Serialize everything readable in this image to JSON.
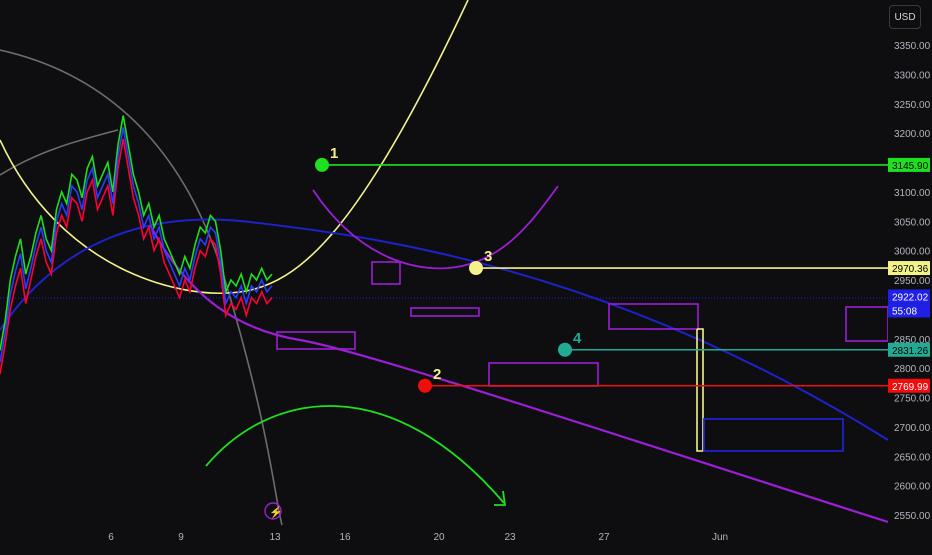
{
  "toolbar": {
    "currency_label": "USD"
  },
  "colors": {
    "background": "#0e0e10",
    "axis_text": "#b2b5be",
    "green_level": "#1ee01e",
    "yellow_level": "#f3f38a",
    "teal_level": "#22ab94",
    "red_level": "#f20d0d",
    "blue_curve": "#1e22cc",
    "purple_curve": "#9b1fd6",
    "gray_curve": "#6b6b70",
    "current_price_bg": "#1f1fe6"
  },
  "chart_data": {
    "type": "line",
    "title": "",
    "xlabel": "",
    "ylabel": "",
    "ylim": [
      2530,
      3375
    ],
    "y_ticks": [
      "3350.00",
      "3300.00",
      "3250.00",
      "3200.00",
      "3150.00",
      "3100.00",
      "3050.00",
      "3000.00",
      "2950.00",
      "2900.00",
      "2850.00",
      "2800.00",
      "2750.00",
      "2700.00",
      "2650.00",
      "2600.00",
      "2550.00"
    ],
    "x_ticks": [
      "6",
      "9",
      "13",
      "16",
      "20",
      "23",
      "27",
      "Jun"
    ],
    "grid": false,
    "price_labels": [
      {
        "name": "level-1",
        "value": "3145.90",
        "color": "#1ee01e",
        "text_color": "#000000"
      },
      {
        "name": "level-3",
        "value": "2970.36",
        "color": "#f3f38a",
        "text_color": "#000000"
      },
      {
        "name": "current-price",
        "value": "2922.02",
        "color": "#1f1fe6",
        "text_color": "#ffffff"
      },
      {
        "name": "countdown",
        "value": "55:08",
        "color": "#1f1fe6",
        "text_color": "#ffffff"
      },
      {
        "name": "level-4",
        "value": "2831.26",
        "color": "#22ab94",
        "text_color": "#000000"
      },
      {
        "name": "level-2",
        "value": "2769.99",
        "color": "#f20d0d",
        "text_color": "#ffffff"
      }
    ],
    "levels": [
      {
        "label": "1",
        "value": 3145.9,
        "color": "#1ee01e",
        "label_color": "#f3f38a"
      },
      {
        "label": "3",
        "value": 2970.36,
        "color": "#f3f38a",
        "label_color": "#f3f38a"
      },
      {
        "label": "4",
        "value": 2831.26,
        "color": "#22ab94",
        "label_color": "#22ab94"
      },
      {
        "label": "2",
        "value": 2769.99,
        "color": "#f20d0d",
        "label_color": "#f3f38a"
      }
    ],
    "series": [
      {
        "color": "#1ee01e",
        "values": [
          2830,
          2880,
          2950,
          2990,
          3020,
          2960,
          2990,
          3030,
          3060,
          3020,
          3000,
          3070,
          3100,
          3080,
          3130,
          3120,
          3090,
          3140,
          3160,
          3110,
          3130,
          3150,
          3100,
          3180,
          3230,
          3180,
          3130,
          3100,
          3060,
          3080,
          3040,
          3060,
          3020,
          3000,
          2980,
          2960,
          2990,
          2970,
          3010,
          3040,
          3030,
          3060,
          3050,
          3000,
          2930,
          2950,
          2940,
          2960,
          2930,
          2960,
          2950,
          2970,
          2950,
          2960
        ]
      },
      {
        "color": "#ff0033",
        "values": [
          2790,
          2840,
          2900,
          2940,
          2970,
          2910,
          2950,
          2990,
          3020,
          2980,
          2960,
          3030,
          3060,
          3040,
          3090,
          3080,
          3050,
          3100,
          3120,
          3070,
          3090,
          3110,
          3060,
          3140,
          3190,
          3140,
          3090,
          3060,
          3020,
          3040,
          3000,
          3020,
          2980,
          2960,
          2940,
          2920,
          2950,
          2930,
          2970,
          3000,
          2990,
          3020,
          3010,
          2960,
          2890,
          2910,
          2900,
          2920,
          2890,
          2920,
          2910,
          2930,
          2910,
          2920
        ]
      },
      {
        "color": "#2a3cff",
        "values": [
          2810,
          2860,
          2925,
          2965,
          2995,
          2935,
          2970,
          3010,
          3040,
          3000,
          2980,
          3050,
          3080,
          3060,
          3110,
          3100,
          3070,
          3120,
          3140,
          3090,
          3110,
          3130,
          3080,
          3160,
          3210,
          3160,
          3110,
          3080,
          3040,
          3060,
          3020,
          3040,
          3000,
          2980,
          2960,
          2940,
          2970,
          2950,
          2990,
          3020,
          3010,
          3040,
          3030,
          2980,
          2910,
          2930,
          2920,
          2940,
          2910,
          2940,
          2930,
          2950,
          2930,
          2940
        ]
      }
    ]
  }
}
